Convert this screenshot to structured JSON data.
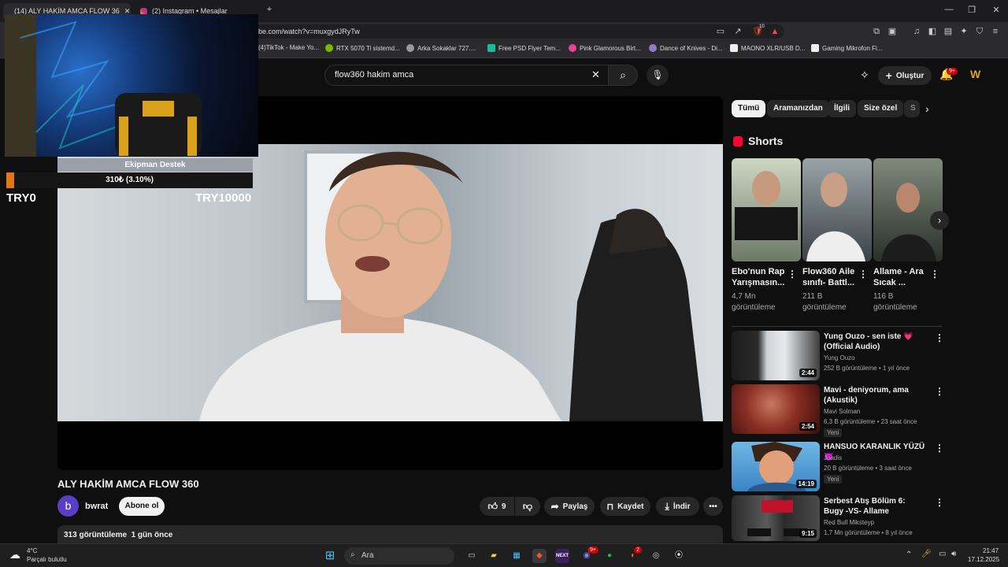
{
  "browser": {
    "tabs": [
      {
        "title": "(14) ALY HAKİM AMCA FLOW 36",
        "active": true
      },
      {
        "title": "(2) Instagram • Mesajlar",
        "active": false
      }
    ],
    "url": "be.com/watch?v=muxgydJRyTw",
    "bookmarks": [
      "(4)TikTok - Make Yo...",
      "RTX 5070 Ti sistemd...",
      "Arka Sokaklar 727....",
      "Free PSD Flyer Tem...",
      "Pink Glamorous Birt...",
      "Dance of Knives - Di...",
      "MAONO XLR/USB D...",
      "Gaming Mikrofon Fi..."
    ],
    "brave_badge": "10"
  },
  "youtube": {
    "search_query": "flow360 hakim amca",
    "create_label": "Oluştur",
    "notifications_badge": "9+"
  },
  "overlay": {
    "donation_label": "Ekipman Destek",
    "donation_progress_text": "310₺ (3.10%)",
    "donation_fraction": 0.031,
    "donation_start": "TRY0",
    "donation_goal": "TRY10000"
  },
  "video": {
    "title": "ALY HAKİM AMCA FLOW 360",
    "channel_initial": "b",
    "channel": "bwrat",
    "subscribe_label": "Abone ol",
    "likes": "9",
    "share_label": "Paylaş",
    "save_label": "Kaydet",
    "download_label": "İndir",
    "stats": "313 görüntüleme  1 gün önce"
  },
  "chips": [
    "Tümü",
    "Aramanızdan",
    "İlgili",
    "Size özel",
    "S"
  ],
  "shorts": {
    "heading": "Shorts",
    "items": [
      {
        "title": "Ebo'nun Rap Yarışmasın...",
        "views": "4,7 Mn görüntüleme"
      },
      {
        "title": "Flow360 Aile sınıfı- Battl...",
        "views": "211 B görüntüleme"
      },
      {
        "title": "Allame - Ara Sıcak ...",
        "views": "116 B görüntüleme"
      }
    ]
  },
  "recommendations": [
    {
      "title": "Yung Ouzo - sen iste 💗 (Official Audio)",
      "channel": "Yung Ouzo",
      "meta": "252 B görüntüleme • 1 yıl önce",
      "duration": "2:44",
      "badge": ""
    },
    {
      "title": "Mavi - deniyorum, ama (Akustik)",
      "channel": "Mavi Solman",
      "meta": "6,3 B görüntüleme • 23 saat önce",
      "duration": "2:54",
      "badge": "Yeni"
    },
    {
      "title": "HANSUO KARANLIK YÜZÜ 😈",
      "channel": "Juadis",
      "meta": "20 B görüntüleme • 3 saat önce",
      "duration": "14:19",
      "badge": "Yeni"
    },
    {
      "title": "Serbest Atış Bölüm 6: Bugy -VS- Allame",
      "channel": "Red Bull Miksteyp",
      "meta": "1,7 Mn görüntüleme • 8 yıl önce",
      "duration": "9:15",
      "badge": ""
    }
  ],
  "taskbar": {
    "weather_temp": "4°C",
    "weather_desc": "Parçalı bulutlu",
    "search_placeholder": "Ara",
    "time": "21:47",
    "date": "17.12.2025",
    "badge_a": "9+",
    "badge_b": "2"
  },
  "colors": {
    "yt_red": "#ff0033",
    "donation_fill": "#e07a10",
    "avatar": "#5a3ec8"
  }
}
